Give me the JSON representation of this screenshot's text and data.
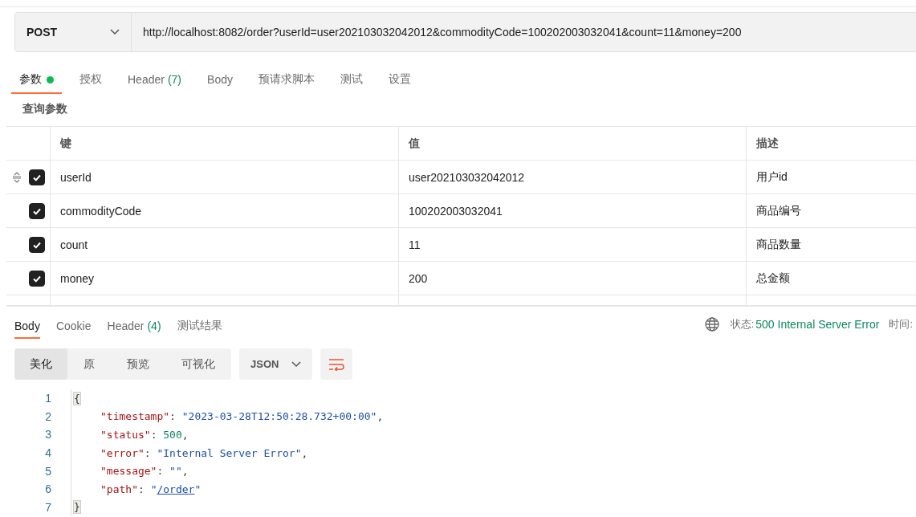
{
  "request": {
    "method": "POST",
    "url": "http://localhost:8082/order?userId=user202103032042012&commodityCode=100202003032041&count=11&money=200"
  },
  "request_tabs": [
    {
      "label": "参数",
      "dot": true,
      "selected": true
    },
    {
      "label": "授权",
      "dot": false,
      "selected": false
    },
    {
      "label": "Header",
      "count": "(7)",
      "dot": false,
      "selected": false
    },
    {
      "label": "Body",
      "dot": false,
      "selected": false
    },
    {
      "label": "预请求脚本",
      "dot": false,
      "selected": false
    },
    {
      "label": "测试",
      "dot": false,
      "selected": false
    },
    {
      "label": "设置",
      "dot": false,
      "selected": false
    }
  ],
  "section_title": "查询参数",
  "params_table": {
    "columns": [
      "键",
      "值",
      "描述"
    ],
    "rows": [
      {
        "key": "userId",
        "value": "user202103032042012",
        "description": "用户id",
        "checked": true,
        "drag_handle": true
      },
      {
        "key": "commodityCode",
        "value": "100202003032041",
        "description": "商品编号",
        "checked": true,
        "drag_handle": false
      },
      {
        "key": "count",
        "value": "11",
        "description": "商品数量",
        "checked": true,
        "drag_handle": false
      },
      {
        "key": "money",
        "value": "200",
        "description": "总金额",
        "checked": true,
        "drag_handle": false
      }
    ]
  },
  "response_tabs": [
    {
      "label": "Body",
      "selected": true
    },
    {
      "label": "Cookie",
      "selected": false
    },
    {
      "label": "Header",
      "count": "(4)",
      "selected": false
    },
    {
      "label": "测试结果",
      "selected": false
    }
  ],
  "status": {
    "label": "状态:",
    "value": "500 Internal Server Error",
    "time_label": "时间:"
  },
  "view_modes": [
    {
      "label": "美化",
      "selected": true
    },
    {
      "label": "原",
      "selected": false
    },
    {
      "label": "预览",
      "selected": false
    },
    {
      "label": "可视化",
      "selected": false
    }
  ],
  "format": "JSON",
  "code_lines": [
    {
      "number": "1",
      "tokens": [
        {
          "kind": "brace",
          "text": "{"
        }
      ]
    },
    {
      "number": "2",
      "tokens": [
        {
          "kind": "key",
          "text": "\"timestamp\""
        },
        {
          "kind": "punct",
          "text": ": "
        },
        {
          "kind": "string",
          "text": "\"2023-03-28T12:50:28.732+00:00\""
        },
        {
          "kind": "punct",
          "text": ","
        }
      ]
    },
    {
      "number": "3",
      "tokens": [
        {
          "kind": "key",
          "text": "\"status\""
        },
        {
          "kind": "punct",
          "text": ": "
        },
        {
          "kind": "number",
          "text": "500"
        },
        {
          "kind": "punct",
          "text": ","
        }
      ]
    },
    {
      "number": "4",
      "tokens": [
        {
          "kind": "key",
          "text": "\"error\""
        },
        {
          "kind": "punct",
          "text": ": "
        },
        {
          "kind": "string",
          "text": "\"Internal Server Error\""
        },
        {
          "kind": "punct",
          "text": ","
        }
      ]
    },
    {
      "number": "5",
      "tokens": [
        {
          "kind": "key",
          "text": "\"message\""
        },
        {
          "kind": "punct",
          "text": ": "
        },
        {
          "kind": "string",
          "text": "\"\""
        },
        {
          "kind": "punct",
          "text": ","
        }
      ]
    },
    {
      "number": "6",
      "tokens": [
        {
          "kind": "key",
          "text": "\"path\""
        },
        {
          "kind": "punct",
          "text": ": "
        },
        {
          "kind": "string",
          "text": "\""
        },
        {
          "kind": "link",
          "text": "/order"
        },
        {
          "kind": "string",
          "text": "\""
        }
      ]
    },
    {
      "number": "7",
      "tokens": [
        {
          "kind": "brace",
          "text": "}"
        }
      ]
    }
  ]
}
